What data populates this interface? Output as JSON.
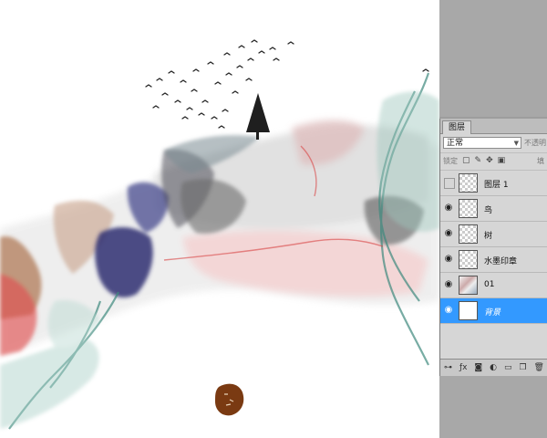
{
  "panel": {
    "tab_label": "图层",
    "blend_mode": "正常",
    "opacity_label": "不透明",
    "lock_label": "锁定",
    "fill_label": "填"
  },
  "layers": [
    {
      "name": "图层 1",
      "visible": false,
      "selected": false
    },
    {
      "name": "鸟",
      "visible": true,
      "selected": false
    },
    {
      "name": "树",
      "visible": true,
      "selected": false
    },
    {
      "name": "水墨印章",
      "visible": true,
      "selected": false
    },
    {
      "name": "01",
      "visible": true,
      "selected": false
    },
    {
      "name": "背景",
      "visible": true,
      "selected": true
    }
  ],
  "icons": {
    "visibility": "eye-icon",
    "lock_transparent": "lock-transparent-icon",
    "lock_paint": "brush-icon",
    "lock_move": "move-icon",
    "lock_all": "lock-icon",
    "footer": [
      "link-icon",
      "fx-icon",
      "mask-icon",
      "adjustment-icon",
      "folder-icon",
      "new-layer-icon",
      "trash-icon"
    ]
  },
  "colors": {
    "selection": "#3399ff",
    "panel_bg": "#d6d6d6",
    "workspace": "#9d9d9d"
  }
}
